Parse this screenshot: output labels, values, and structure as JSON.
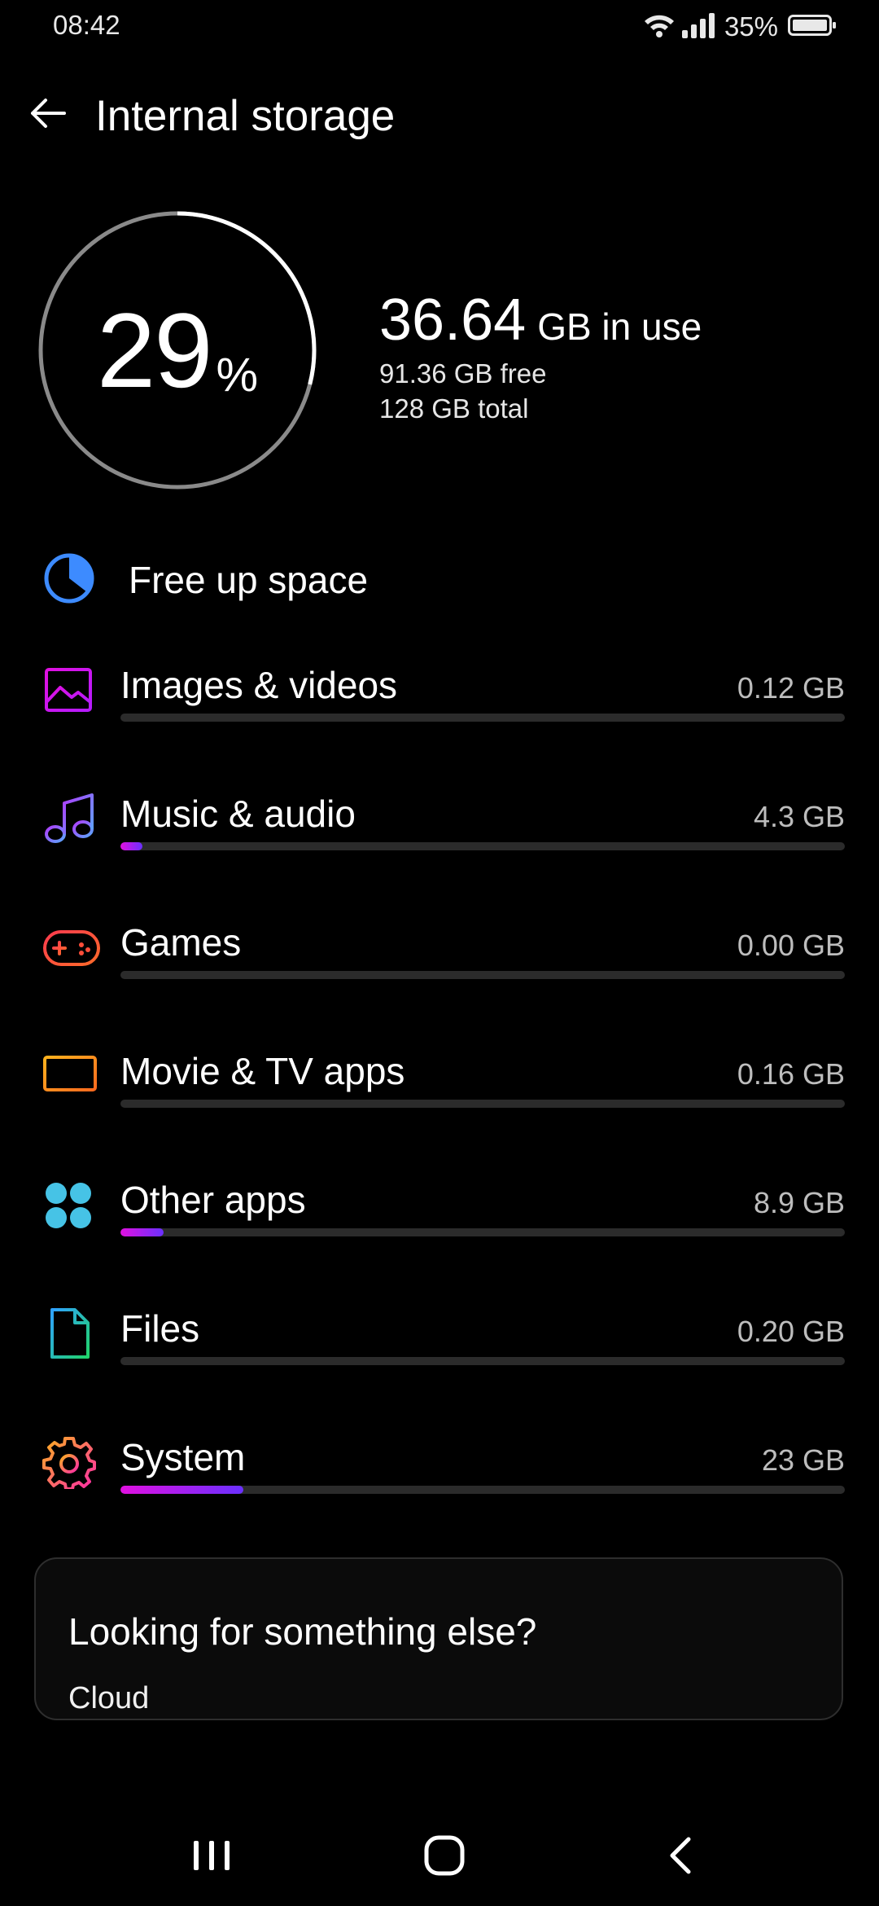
{
  "status_bar": {
    "time": "08:42",
    "battery": "35%"
  },
  "header": {
    "title": "Internal storage"
  },
  "summary": {
    "percent": "29",
    "percent_sign": "%",
    "used_value": "36.64",
    "used_suffix": "GB in use",
    "free": "91.36 GB free",
    "total": "128 GB total",
    "used_fraction": 0.29
  },
  "free_up": {
    "label": "Free up space"
  },
  "categories": [
    {
      "label": "Images & videos",
      "size": "0.12 GB",
      "fraction": 0.0
    },
    {
      "label": "Music & audio",
      "size": "4.3 GB",
      "fraction": 0.03
    },
    {
      "label": "Games",
      "size": "0.00 GB",
      "fraction": 0.0
    },
    {
      "label": "Movie & TV apps",
      "size": "0.16 GB",
      "fraction": 0.0
    },
    {
      "label": "Other apps",
      "size": "8.9 GB",
      "fraction": 0.06
    },
    {
      "label": "Files",
      "size": "0.20 GB",
      "fraction": 0.0
    },
    {
      "label": "System",
      "size": "23 GB",
      "fraction": 0.17
    }
  ],
  "card": {
    "title": "Looking for something else?",
    "link": "Cloud"
  },
  "colors": {
    "accent_from": "#e010e0",
    "accent_to": "#6a30ff",
    "background": "#000000"
  },
  "icons": [
    "back-arrow-icon",
    "wifi-icon",
    "signal-icon",
    "battery-icon",
    "pie-icon",
    "image-icon",
    "music-note-icon",
    "gamepad-icon",
    "tv-icon",
    "apps-grid-icon",
    "file-icon",
    "gear-icon",
    "recents-icon",
    "home-icon",
    "nav-back-icon"
  ]
}
